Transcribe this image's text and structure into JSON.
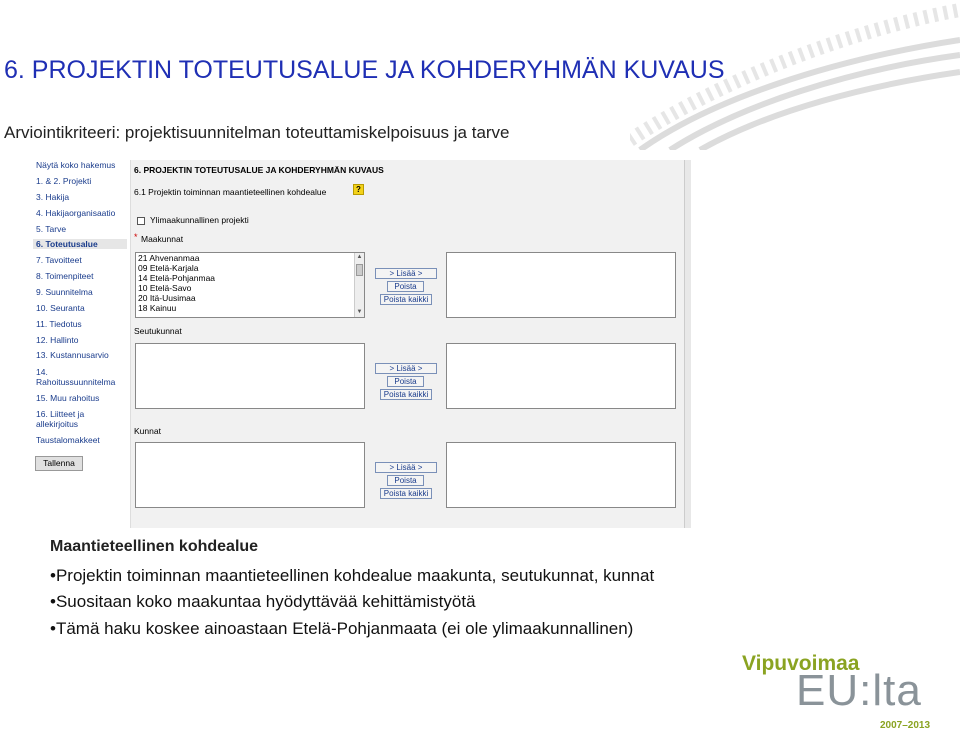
{
  "slide": {
    "title": "6. PROJEKTIN TOTEUTUSALUE JA KOHDERYHMÄN KUVAUS",
    "subtitle": "Arviointikriteeri: projektisuunnitelman toteuttamiskelpoisuus ja tarve"
  },
  "colors": {
    "title": "#1f2fb4",
    "logo_green": "#8aa321",
    "logo_grey": "#8a9399"
  },
  "screenshot": {
    "nav": {
      "items": [
        {
          "label": "Näytä koko hakemus"
        },
        {
          "label": "1. & 2. Projekti"
        },
        {
          "label": "3. Hakija"
        },
        {
          "label": "4. Hakijaorganisaatio"
        },
        {
          "label": "5. Tarve"
        },
        {
          "label": "6. Toteutusalue",
          "active": true
        },
        {
          "label": "7. Tavoitteet"
        },
        {
          "label": "8. Toimenpiteet"
        },
        {
          "label": "9. Suunnitelma"
        },
        {
          "label": "10. Seuranta"
        },
        {
          "label": "11. Tiedotus"
        },
        {
          "label": "12. Hallinto"
        },
        {
          "label": "13. Kustannusarvio"
        },
        {
          "label": "14."
        },
        {
          "label": "Rahoitussuunnitelma"
        },
        {
          "label": "15. Muu rahoitus"
        },
        {
          "label": "16. Liitteet ja"
        },
        {
          "label": "allekirjoitus"
        },
        {
          "label": "Taustalomakkeet"
        }
      ],
      "save_label": "Tallenna"
    },
    "form": {
      "heading": "6. PROJEKTIN TOTEUTUSALUE JA KOHDERYHMÄN KUVAUS",
      "subheading": "6.1 Projektin toiminnan maantieteellinen kohdealue",
      "help": "?",
      "checkbox_label": "Ylimaakunnallinen projekti",
      "required_mark": "*",
      "maakunnat_label": "Maakunnat",
      "maakunnat_options": [
        "21 Ahvenanmaa",
        "09 Etelä-Karjala",
        "14 Etelä-Pohjanmaa",
        "10 Etelä-Savo",
        "20 Itä-Uusimaa",
        "18 Kainuu"
      ],
      "seutukunnat_label": "Seutukunnat",
      "kunnat_label": "Kunnat",
      "add_label": "> Lisää >",
      "remove_label": "Poista",
      "remove_all_label": "Poista kaikki"
    }
  },
  "section": {
    "title": "Maantieteellinen kohdealue",
    "bullets": [
      "•Projektin toiminnan maantieteellinen kohdealue maakunta, seutukunnat, kunnat",
      "•Suositaan koko maakuntaa hyödyttävää kehittämistyötä",
      "•Tämä haku koskee ainoastaan Etelä-Pohjanmaata (ei ole ylimaakunnallinen)"
    ]
  },
  "logo": {
    "top": "Vipuvoimaa",
    "main": "EU:lta",
    "years": "2007–2013"
  }
}
